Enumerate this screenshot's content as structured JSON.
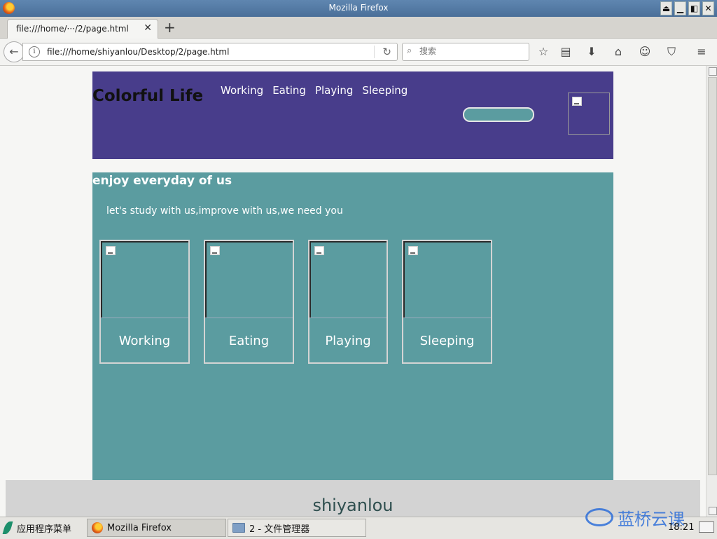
{
  "window": {
    "title": "Mozilla Firefox",
    "controls": [
      "⏏",
      "▁",
      "◧",
      "✕"
    ]
  },
  "tab": {
    "label": "file:///home/···/2/page.html",
    "close": "✕",
    "new_tab": "+"
  },
  "navbar": {
    "url": "file:///home/shiyanlou/Desktop/2/page.html",
    "search_placeholder": "搜索",
    "icons": [
      "star-icon",
      "reading-list-icon",
      "download-icon",
      "home-icon",
      "emoji-icon",
      "pocket-icon",
      "menu-icon"
    ]
  },
  "site": {
    "logo": "Colorful Life",
    "nav": [
      "Working",
      "Eating",
      "Playing",
      "Sleeping"
    ],
    "main_title": "enjoy everyday of us",
    "subtitle": "let's study with us,improve with us,we need you",
    "cards": [
      "Working",
      "Eating",
      "Playing",
      "Sleeping"
    ],
    "footer": "shiyanlou",
    "colors": {
      "header_bg": "#483d8b",
      "main_bg": "#5b9ca0",
      "footer_bg": "#d3d3d3"
    }
  },
  "taskbar": {
    "start_label": "应用程序菜单",
    "tasks": [
      "Mozilla Firefox",
      "2 - 文件管理器"
    ],
    "watermark": "蓝桥云课",
    "clock": "18:21"
  }
}
